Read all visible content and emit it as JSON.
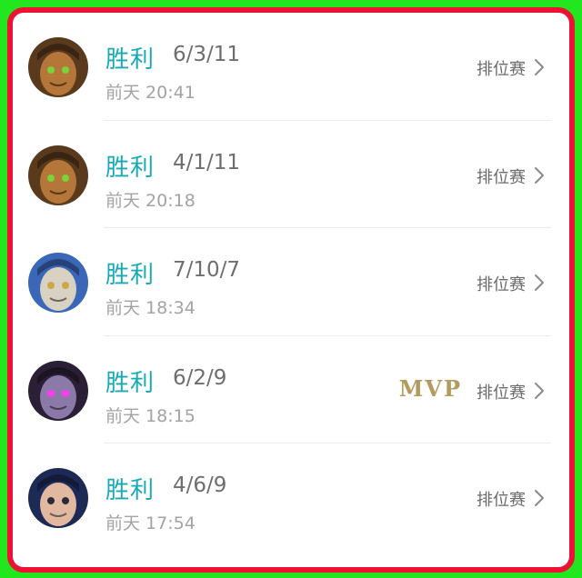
{
  "matches": [
    {
      "result": "胜利",
      "kda": "6/3/11",
      "time": "前天 20:41",
      "mode": "排位赛",
      "mvp": "",
      "avatar": {
        "name": "hero-avatar-1",
        "bg": "#5a3a1c",
        "face": "#b5763a",
        "accent": "#7bd23a"
      }
    },
    {
      "result": "胜利",
      "kda": "4/1/11",
      "time": "前天 20:18",
      "mode": "排位赛",
      "mvp": "",
      "avatar": {
        "name": "hero-avatar-2",
        "bg": "#5a3a1c",
        "face": "#b5763a",
        "accent": "#7bd23a"
      }
    },
    {
      "result": "胜利",
      "kda": "7/10/7",
      "time": "前天 18:34",
      "mode": "排位赛",
      "mvp": "",
      "avatar": {
        "name": "hero-avatar-3",
        "bg": "#3b67b8",
        "face": "#d9d2c2",
        "accent": "#caa84a"
      }
    },
    {
      "result": "胜利",
      "kda": "6/2/9",
      "time": "前天 18:15",
      "mode": "排位赛",
      "mvp": "MVP",
      "avatar": {
        "name": "hero-avatar-4",
        "bg": "#2a1f35",
        "face": "#8b7aa8",
        "accent": "#ff3cf0"
      }
    },
    {
      "result": "胜利",
      "kda": "4/6/9",
      "time": "前天 17:54",
      "mode": "排位赛",
      "mvp": "",
      "avatar": {
        "name": "hero-avatar-5",
        "bg": "#1c2a55",
        "face": "#e2b9a0",
        "accent": "#2b2b38"
      }
    }
  ],
  "colors": {
    "result": "#17aab4",
    "mvp": "#b39a5e",
    "frame": "#ee1133",
    "outer": "#22e61e"
  }
}
